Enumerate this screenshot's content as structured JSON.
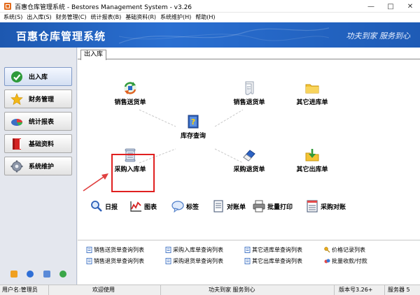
{
  "window": {
    "title": "百惠仓库管理系统 - Bestores Management System - v3.26",
    "controls": [
      "minimize",
      "maximize",
      "close"
    ]
  },
  "menu": [
    "系统(S)",
    "出入库(S)",
    "财务管理(C)",
    "统计报表(B)",
    "基础资料(R)",
    "系统维护(H)",
    "帮助(H)"
  ],
  "banner": {
    "title": "百惠仓库管理系统",
    "slogan": "功夫到家  服务到心",
    "color": "#2a6fd1"
  },
  "sidebar": {
    "items": [
      {
        "label": "出入库",
        "icon": "check-icon",
        "active": true
      },
      {
        "label": "财务管理",
        "icon": "star-icon",
        "active": false
      },
      {
        "label": "统计报表",
        "icon": "pie-chart-icon",
        "active": false
      },
      {
        "label": "基础资料",
        "icon": "book-icon",
        "active": false
      },
      {
        "label": "系统维护",
        "icon": "gear-icon",
        "active": false
      }
    ],
    "bottom_icons": [
      "help-icon",
      "info-icon",
      "search-icon",
      "exit-icon"
    ]
  },
  "tabs": [
    {
      "label": "出入库",
      "active": true
    }
  ],
  "diagram": {
    "nodes": {
      "sales_delivery": "销售送货单",
      "inventory_query": "库存查询",
      "sales_return": "销售退货单",
      "other_inbound": "其它进库单",
      "purchase_inbound": "采购入库单",
      "purchase_return": "采购退货单",
      "other_outbound": "其它出库单"
    }
  },
  "toolbar": [
    "日报",
    "图表",
    "标签",
    "对账单",
    "批量打印",
    "采购对账"
  ],
  "links": [
    "销售送货单查询列表",
    "采购入库单查询列表",
    "其它进库单查询列表",
    "价格记录列表",
    "销售退货单查询列表",
    "采购退货单查询列表",
    "其它出库单查询列表",
    "批量收款/付款"
  ],
  "status": {
    "user": "用户名:管理员",
    "welcome": "欢迎使用",
    "slogan": "功夫到家  服务到心",
    "version": "版本号3.26+",
    "service": "服务器 5"
  }
}
